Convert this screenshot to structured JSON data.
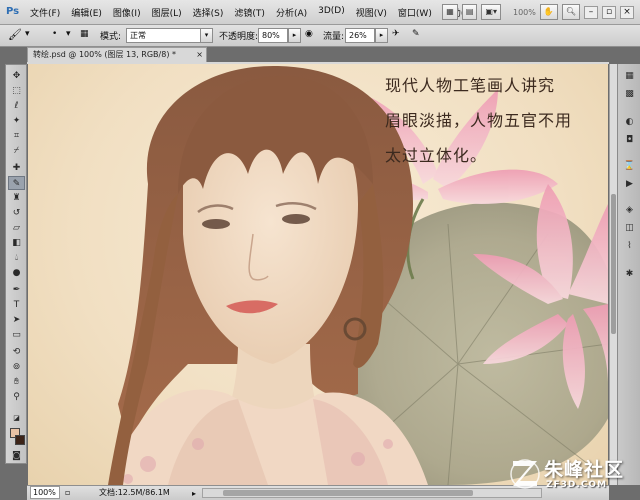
{
  "app": {
    "logo": "Ps"
  },
  "menu": {
    "items": [
      "文件(F)",
      "编辑(E)",
      "图像(I)",
      "图层(L)",
      "选择(S)",
      "滤镜(T)",
      "分析(A)",
      "3D(D)",
      "视图(V)",
      "窗口(W)",
      "帮助(H)"
    ],
    "zoom": "100%"
  },
  "options": {
    "mode_label": "模式:",
    "mode_value": "正常",
    "opacity_label": "不透明度:",
    "opacity_value": "80%",
    "flow_label": "流量:",
    "flow_value": "26%"
  },
  "document": {
    "tab_title": "转绘.psd @ 100% (图层 13, RGB/8) *",
    "close": "×"
  },
  "canvas": {
    "poem_lines": [
      "现代人物工笔画人讲究",
      "眉眼淡描，人物五官不用",
      "太过立体化。"
    ]
  },
  "status": {
    "zoom": "100%",
    "doc_info": "文档:12.5M/86.1M"
  },
  "watermark": {
    "name": "朱峰社区",
    "domain": "ZF3D.COM"
  },
  "colors": {
    "foreground": "#e9c2a4",
    "background": "#3d2418"
  }
}
